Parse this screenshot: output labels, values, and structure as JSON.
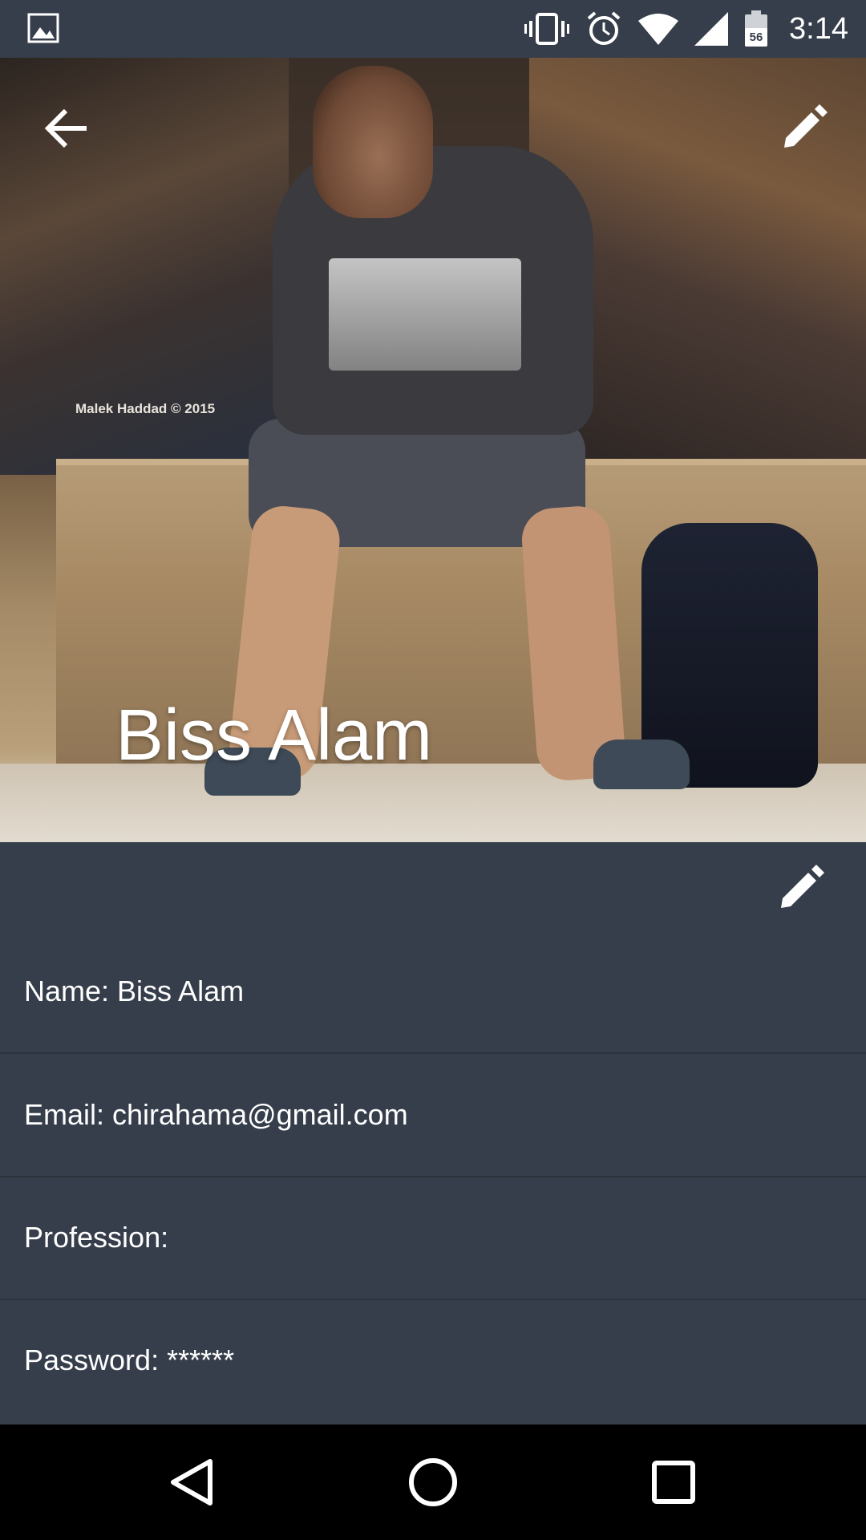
{
  "status_bar": {
    "time": "3:14",
    "battery_level": "56",
    "icons": [
      "gallery-icon",
      "vibrate-icon",
      "alarm-icon",
      "wifi-icon",
      "signal-icon",
      "battery-icon"
    ]
  },
  "header": {
    "profile_name": "Biss Alam",
    "photo_watermark": "Malek Haddad © 2015",
    "back_icon": "arrow-back-icon",
    "edit_icon": "pencil-icon"
  },
  "details": {
    "edit_icon": "pencil-icon",
    "rows": [
      {
        "text": "Name: Biss Alam"
      },
      {
        "text": "Email: chirahama@gmail.com"
      },
      {
        "text": "Profession:"
      },
      {
        "text": "Password: ******"
      }
    ]
  },
  "nav_bar": {
    "buttons": [
      "back-triangle-icon",
      "home-circle-icon",
      "recents-square-icon"
    ]
  },
  "colors": {
    "panel_bg": "#363e4b",
    "divider": "#2c333d",
    "text": "#ffffff",
    "nav_bg": "#000000"
  }
}
